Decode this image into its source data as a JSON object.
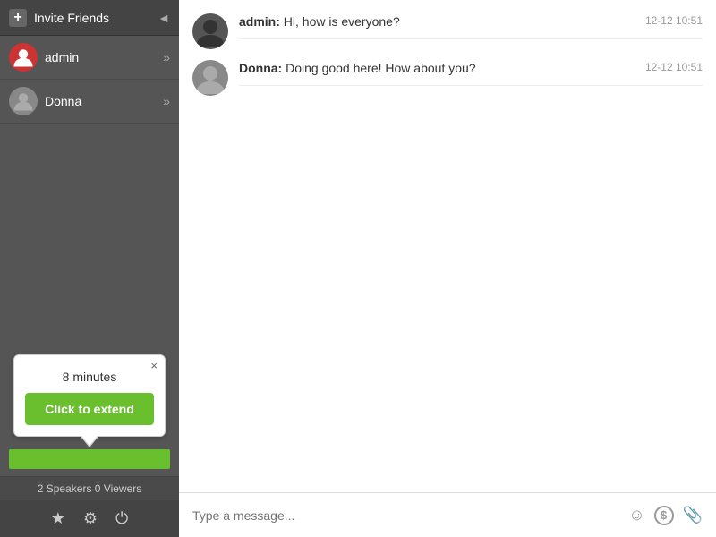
{
  "sidebar": {
    "header": {
      "title": "Invite Friends",
      "add_icon": "+",
      "collapse_icon": "◄"
    },
    "users": [
      {
        "name": "admin",
        "type": "admin"
      },
      {
        "name": "Donna",
        "type": "default"
      }
    ],
    "tooltip": {
      "minutes_label": "8 minutes",
      "extend_label": "Click to extend",
      "close_icon": "×"
    },
    "stats": "2 Speakers  0 Viewers",
    "actions": {
      "star_icon": "★",
      "gear_icon": "⚙",
      "power_icon": "⏻"
    }
  },
  "chat": {
    "messages": [
      {
        "sender": "admin",
        "text": "Hi, how is everyone?",
        "timestamp": "12-12 10:51",
        "type": "admin"
      },
      {
        "sender": "Donna",
        "text": "Doing good here! How about you?",
        "timestamp": "12-12 10:51",
        "type": "default"
      }
    ],
    "input_placeholder": "Type a message..."
  }
}
